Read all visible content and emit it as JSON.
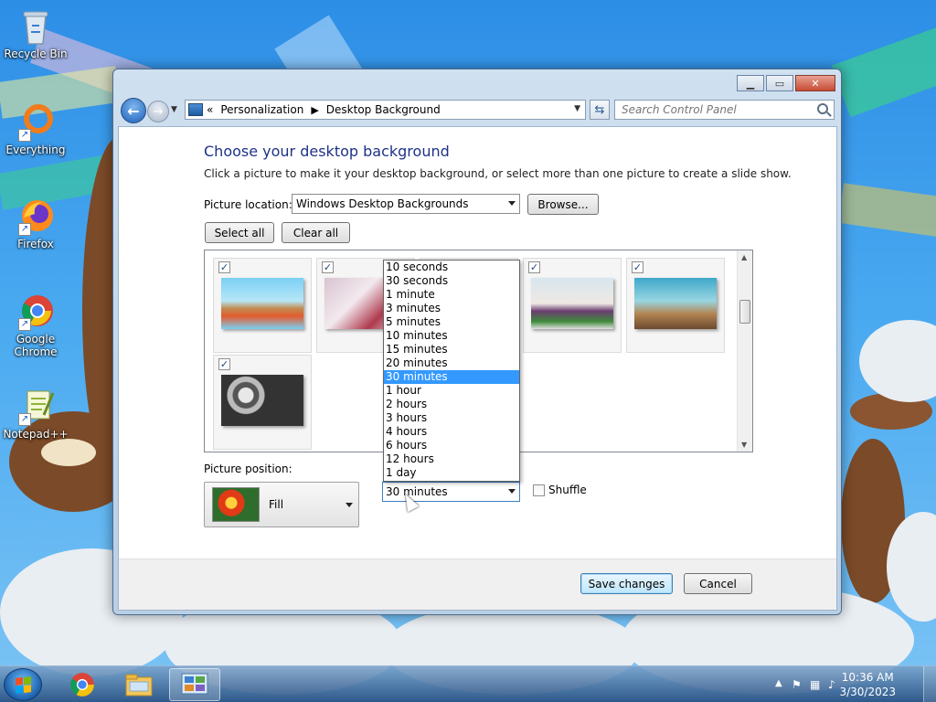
{
  "desktop": {
    "icons": [
      {
        "label": "Recycle Bin"
      },
      {
        "label": "Everything"
      },
      {
        "label": "Firefox"
      },
      {
        "label": "Google Chrome"
      },
      {
        "label": "Notepad++"
      }
    ]
  },
  "window": {
    "breadcrumb": {
      "chevron": "«",
      "items": [
        "Personalization",
        "Desktop Background"
      ]
    },
    "search_placeholder": "Search Control Panel",
    "heading": "Choose your desktop background",
    "description": "Click a picture to make it your desktop background, or select more than one picture to create a slide show.",
    "picture_location_label": "Picture location:",
    "picture_location_value": "Windows Desktop Backgrounds",
    "browse_label": "Browse...",
    "select_all_label": "Select all",
    "clear_all_label": "Clear all",
    "thumbnails": [
      {
        "checked": true
      },
      {
        "checked": true
      },
      {
        "checked": true
      },
      {
        "checked": true
      },
      {
        "checked": true
      },
      {
        "checked": true
      }
    ],
    "picture_position_label": "Picture position:",
    "picture_position_value": "Fill",
    "interval": {
      "value": "30 minutes",
      "options": [
        "10 seconds",
        "30 seconds",
        "1 minute",
        "3 minutes",
        "5 minutes",
        "10 minutes",
        "15 minutes",
        "20 minutes",
        "30 minutes",
        "1 hour",
        "2 hours",
        "3 hours",
        "4 hours",
        "6 hours",
        "12 hours",
        "1 day"
      ],
      "selected": "30 minutes"
    },
    "shuffle_label": "Shuffle",
    "shuffle_checked": false,
    "save_label": "Save changes",
    "cancel_label": "Cancel"
  },
  "taskbar": {
    "time": "10:36 AM",
    "date": "3/30/2023"
  }
}
